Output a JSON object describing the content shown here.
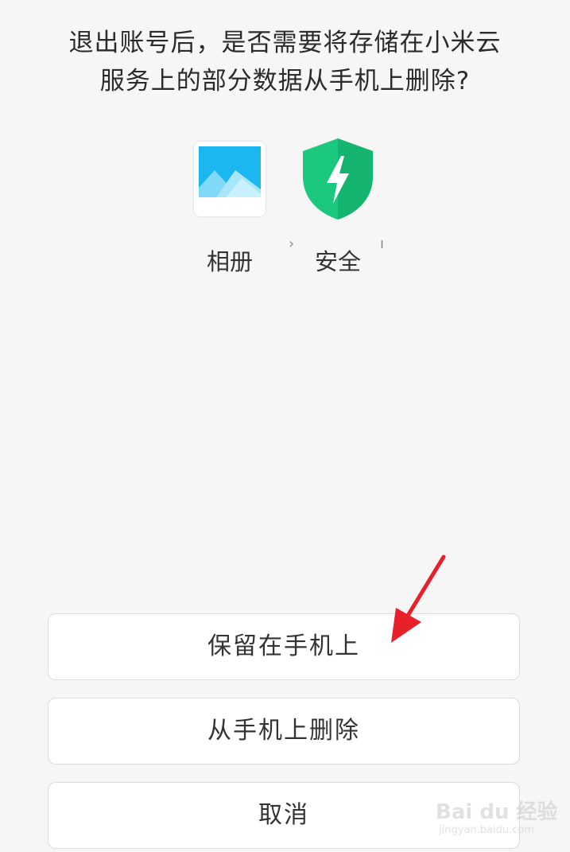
{
  "dialog": {
    "prompt_line_1": "退出账号后，是否需要将存储在小米云",
    "prompt_line_2": "服务上的部分数据从手机上删除?"
  },
  "apps": [
    {
      "label": "相册",
      "icon": "gallery-icon"
    },
    {
      "label": "安全",
      "icon": "security-shield-icon"
    }
  ],
  "separator": "›",
  "buttons": {
    "keep": "保留在手机上",
    "delete": "从手机上删除",
    "cancel": "取消"
  },
  "watermark": {
    "brand": "Bai du 经验",
    "url": "jingyan.baidu.com"
  },
  "colors": {
    "background": "#f6f6f6",
    "button_bg": "#ffffff",
    "gallery_sky": "#1ab7f0",
    "security_green": "#1cc77e",
    "annotation_red": "#e8202a"
  }
}
